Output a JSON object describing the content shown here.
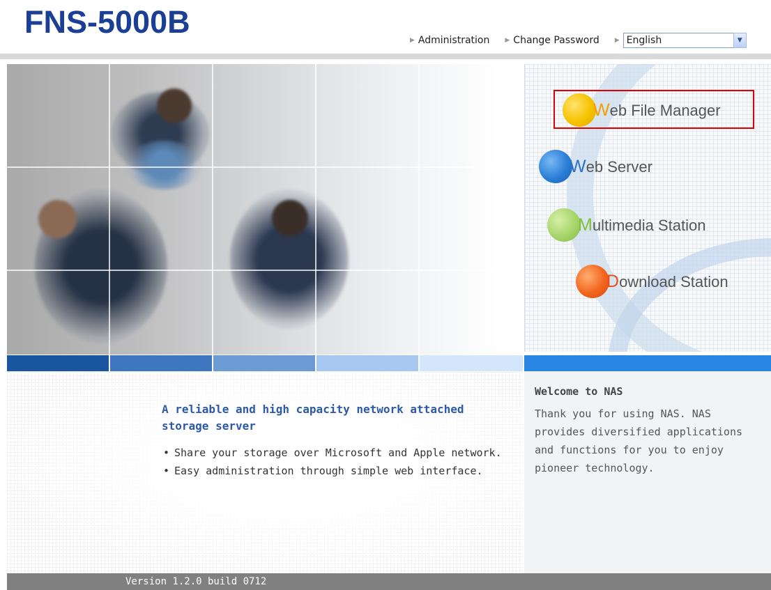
{
  "header": {
    "logo": "FNS-5000B",
    "links": [
      {
        "label": "Administration"
      },
      {
        "label": "Change Password"
      }
    ],
    "language": {
      "selected": "English"
    }
  },
  "services": [
    {
      "initial": "W",
      "rest": "eb File Manager",
      "color": "#f5c200",
      "initial_color": "#f0a000"
    },
    {
      "initial": "W",
      "rest": "eb Server",
      "color": "#2a7fd6",
      "initial_color": "#2a6fc8"
    },
    {
      "initial": "M",
      "rest": "ultimedia Station",
      "color": "#a6d46a",
      "initial_color": "#7fbf3a"
    },
    {
      "initial": "D",
      "rest": "ownload Station",
      "color": "#f2641e",
      "initial_color": "#e6501a"
    }
  ],
  "colorbar": [
    "#1a56a0",
    "#3e77c0",
    "#6b9ad4",
    "#a6c8f0",
    "#d4e6fb",
    "#2a86e4"
  ],
  "intro": {
    "tagline": "A reliable and high capacity network attached storage server",
    "bullets": [
      "Share your storage over Microsoft and Apple network.",
      "Easy administration through simple web interface."
    ]
  },
  "welcome": {
    "title": "Welcome to NAS",
    "text": "Thank you for using NAS. NAS provides diversified applications and functions for you to enjoy pioneer technology."
  },
  "footer": {
    "version": "Version 1.2.0 build 0712"
  }
}
